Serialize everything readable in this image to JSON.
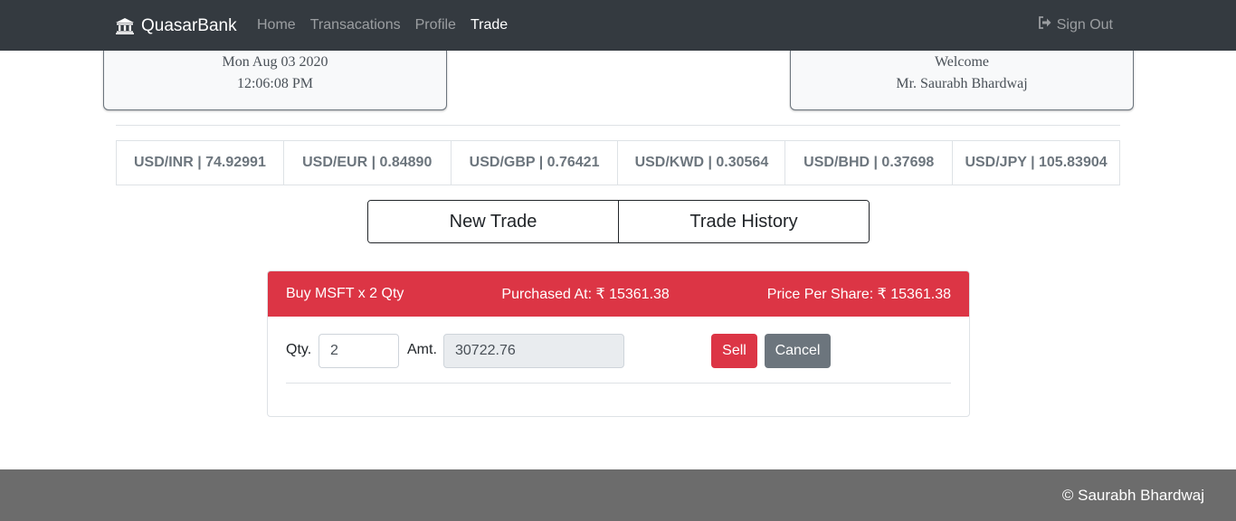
{
  "navbar": {
    "brand": "QuasarBank",
    "brand_icon": "bank-icon",
    "links": [
      {
        "label": "Home",
        "active": false
      },
      {
        "label": "Transacations",
        "active": false
      },
      {
        "label": "Profile",
        "active": false
      },
      {
        "label": "Trade",
        "active": true
      }
    ],
    "signout_label": "Sign Out",
    "signout_icon": "sign-out-icon",
    "bg_color": "#343a40"
  },
  "datetime_card": {
    "date": "Mon Aug 03 2020",
    "time": "12:06:08 PM"
  },
  "welcome_card": {
    "greeting": "Welcome",
    "name": "Mr. Saurabh Bhardwaj"
  },
  "rates": [
    "USD/INR | 74.92991",
    "USD/EUR | 0.84890",
    "USD/GBP | 0.76421",
    "USD/KWD | 0.30564",
    "USD/BHD | 0.37698",
    "USD/JPY | 105.83904"
  ],
  "trade_tabs": {
    "new_trade": "New Trade",
    "trade_history": "Trade History"
  },
  "trade_card": {
    "header_color": "#dc3545",
    "title": "Buy MSFT x 2 Qty",
    "purchased_at": "Purchased At: ₹ 15361.38",
    "price_per_share": "Price Per Share: ₹ 15361.38",
    "qty_label": "Qty.",
    "qty_value": "2",
    "amt_label": "Amt.",
    "amt_value": "30722.76",
    "sell_label": "Sell",
    "cancel_label": "Cancel"
  },
  "footer": {
    "text": "© Saurabh Bhardwaj"
  }
}
